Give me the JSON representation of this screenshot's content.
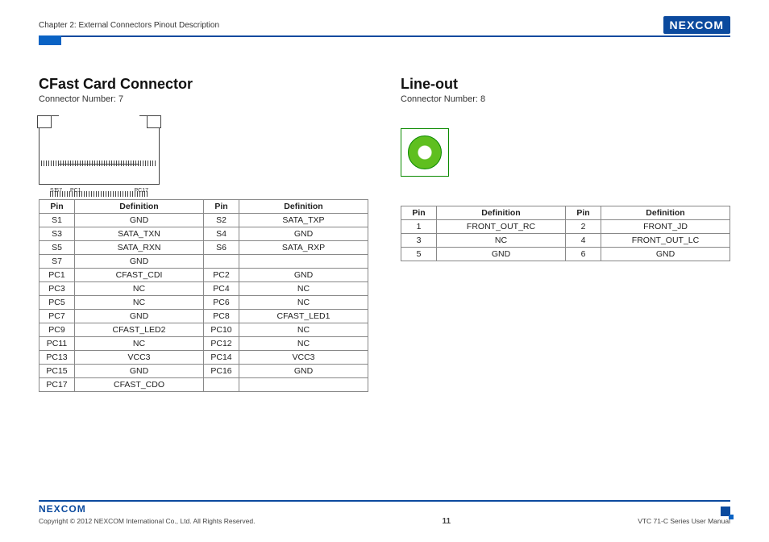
{
  "header": {
    "chapter": "Chapter 2: External Connectors Pinout Description",
    "brand": "NEXCOM"
  },
  "left": {
    "title": "CFast Card Connector",
    "connnum_label": "Connector Number: 7",
    "pinlabels": {
      "a": "S1",
      "b": "S7",
      "c": "PC1",
      "d": "PC17"
    },
    "th": {
      "pin": "Pin",
      "def": "Definition"
    },
    "rows": [
      {
        "p1": "S1",
        "d1": "GND",
        "p2": "S2",
        "d2": "SATA_TXP"
      },
      {
        "p1": "S3",
        "d1": "SATA_TXN",
        "p2": "S4",
        "d2": "GND"
      },
      {
        "p1": "S5",
        "d1": "SATA_RXN",
        "p2": "S6",
        "d2": "SATA_RXP"
      },
      {
        "p1": "S7",
        "d1": "GND",
        "p2": "",
        "d2": ""
      },
      {
        "p1": "PC1",
        "d1": "CFAST_CDI",
        "p2": "PC2",
        "d2": "GND"
      },
      {
        "p1": "PC3",
        "d1": "NC",
        "p2": "PC4",
        "d2": "NC"
      },
      {
        "p1": "PC5",
        "d1": "NC",
        "p2": "PC6",
        "d2": "NC"
      },
      {
        "p1": "PC7",
        "d1": "GND",
        "p2": "PC8",
        "d2": "CFAST_LED1"
      },
      {
        "p1": "PC9",
        "d1": "CFAST_LED2",
        "p2": "PC10",
        "d2": "NC"
      },
      {
        "p1": "PC11",
        "d1": "NC",
        "p2": "PC12",
        "d2": "NC"
      },
      {
        "p1": "PC13",
        "d1": "VCC3",
        "p2": "PC14",
        "d2": "VCC3"
      },
      {
        "p1": "PC15",
        "d1": "GND",
        "p2": "PC16",
        "d2": "GND"
      },
      {
        "p1": "PC17",
        "d1": "CFAST_CDO",
        "p2": "",
        "d2": ""
      }
    ]
  },
  "right": {
    "title": "Line-out",
    "connnum_label": "Connector Number: 8",
    "th": {
      "pin": "Pin",
      "def": "Definition"
    },
    "rows": [
      {
        "p1": "1",
        "d1": "FRONT_OUT_RC",
        "p2": "2",
        "d2": "FRONT_JD"
      },
      {
        "p1": "3",
        "d1": "NC",
        "p2": "4",
        "d2": "FRONT_OUT_LC"
      },
      {
        "p1": "5",
        "d1": "GND",
        "p2": "6",
        "d2": "GND"
      }
    ]
  },
  "footer": {
    "brand": "NEXCOM",
    "copyright": "Copyright © 2012 NEXCOM International Co., Ltd. All Rights Reserved.",
    "page": "11",
    "manual": "VTC 71-C Series User Manual"
  }
}
